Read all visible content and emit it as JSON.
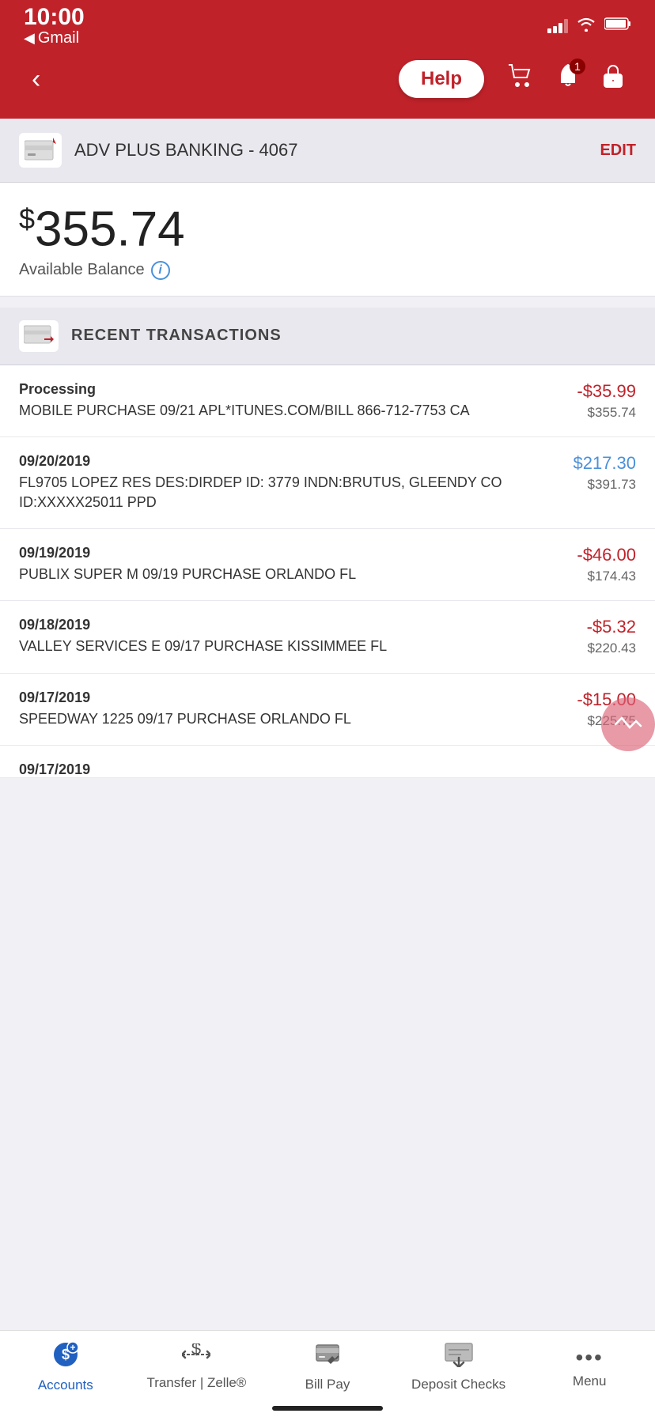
{
  "statusBar": {
    "time": "10:00",
    "carrier": "Gmail",
    "backArrow": "◀"
  },
  "navBar": {
    "backLabel": "‹",
    "helpLabel": "Help",
    "notificationBadge": "1"
  },
  "accountHeader": {
    "accountName": "ADV PLUS BANKING - 4067",
    "editLabel": "EDIT"
  },
  "balance": {
    "dollarSign": "$",
    "amount": "355.74",
    "label": "Available Balance",
    "infoIcon": "i"
  },
  "recentTransactions": {
    "title": "RECENT TRANSACTIONS",
    "transactions": [
      {
        "date": "Processing",
        "description": "MOBILE PURCHASE 09/21 APL*ITUNES.COM/BILL 866-712-7753 CA",
        "amount": "-$35.99",
        "balance": "$355.74",
        "amountType": "negative"
      },
      {
        "date": "09/20/2019",
        "description": "FL9705 LOPEZ RES DES:DIRDEP ID: 3779 INDN:BRUTUS, GLEENDY CO ID:XXXXX25011 PPD",
        "amount": "$217.30",
        "balance": "$391.73",
        "amountType": "positive"
      },
      {
        "date": "09/19/2019",
        "description": "PUBLIX SUPER M 09/19 PURCHASE ORLANDO FL",
        "amount": "-$46.00",
        "balance": "$174.43",
        "amountType": "negative"
      },
      {
        "date": "09/18/2019",
        "description": "VALLEY SERVICES E 09/17 PURCHASE KISSIMMEE FL",
        "amount": "-$5.32",
        "balance": "$220.43",
        "amountType": "negative"
      },
      {
        "date": "09/17/2019",
        "description": "SPEEDWAY 1225 09/17 PURCHASE ORLANDO FL",
        "amount": "-$15.00",
        "balance": "$225.75",
        "amountType": "negative"
      },
      {
        "date": "09/17/2019",
        "description": "",
        "amount": "",
        "balance": "",
        "amountType": ""
      }
    ]
  },
  "bottomNav": {
    "items": [
      {
        "label": "Accounts",
        "icon": "💲",
        "active": true,
        "badge": "+"
      },
      {
        "label": "Transfer | Zelle®",
        "icon": "💱",
        "active": false
      },
      {
        "label": "Bill Pay",
        "icon": "💵",
        "active": false
      },
      {
        "label": "Deposit Checks",
        "icon": "📄",
        "active": false
      },
      {
        "label": "Menu",
        "icon": "•••",
        "active": false
      }
    ]
  }
}
